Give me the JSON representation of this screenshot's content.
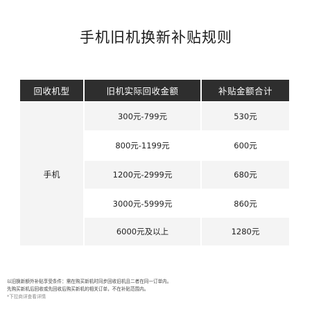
{
  "title": "手机旧机换新补贴规则",
  "table": {
    "headers": [
      "回收机型",
      "旧机实际回收金额",
      "补贴金额合计"
    ],
    "model": "手机",
    "rows": [
      {
        "range": "300元-799元",
        "subsidy": "530元"
      },
      {
        "range": "800元-1199元",
        "subsidy": "600元"
      },
      {
        "range": "1200元-2999元",
        "subsidy": "680元"
      },
      {
        "range": "3000元-5999元",
        "subsidy": "860元"
      },
      {
        "range": "6000元及以上",
        "subsidy": "1280元"
      }
    ]
  },
  "notes": {
    "line1": "以旧换新额外补贴享受条件：需在购买新机时同步回收旧机且二者在同一订单内。",
    "line2": "先购买新机后回收或先回收后购买新机的相关订单，不在补贴范围内。",
    "line3": "*下拉商详查看详情"
  }
}
